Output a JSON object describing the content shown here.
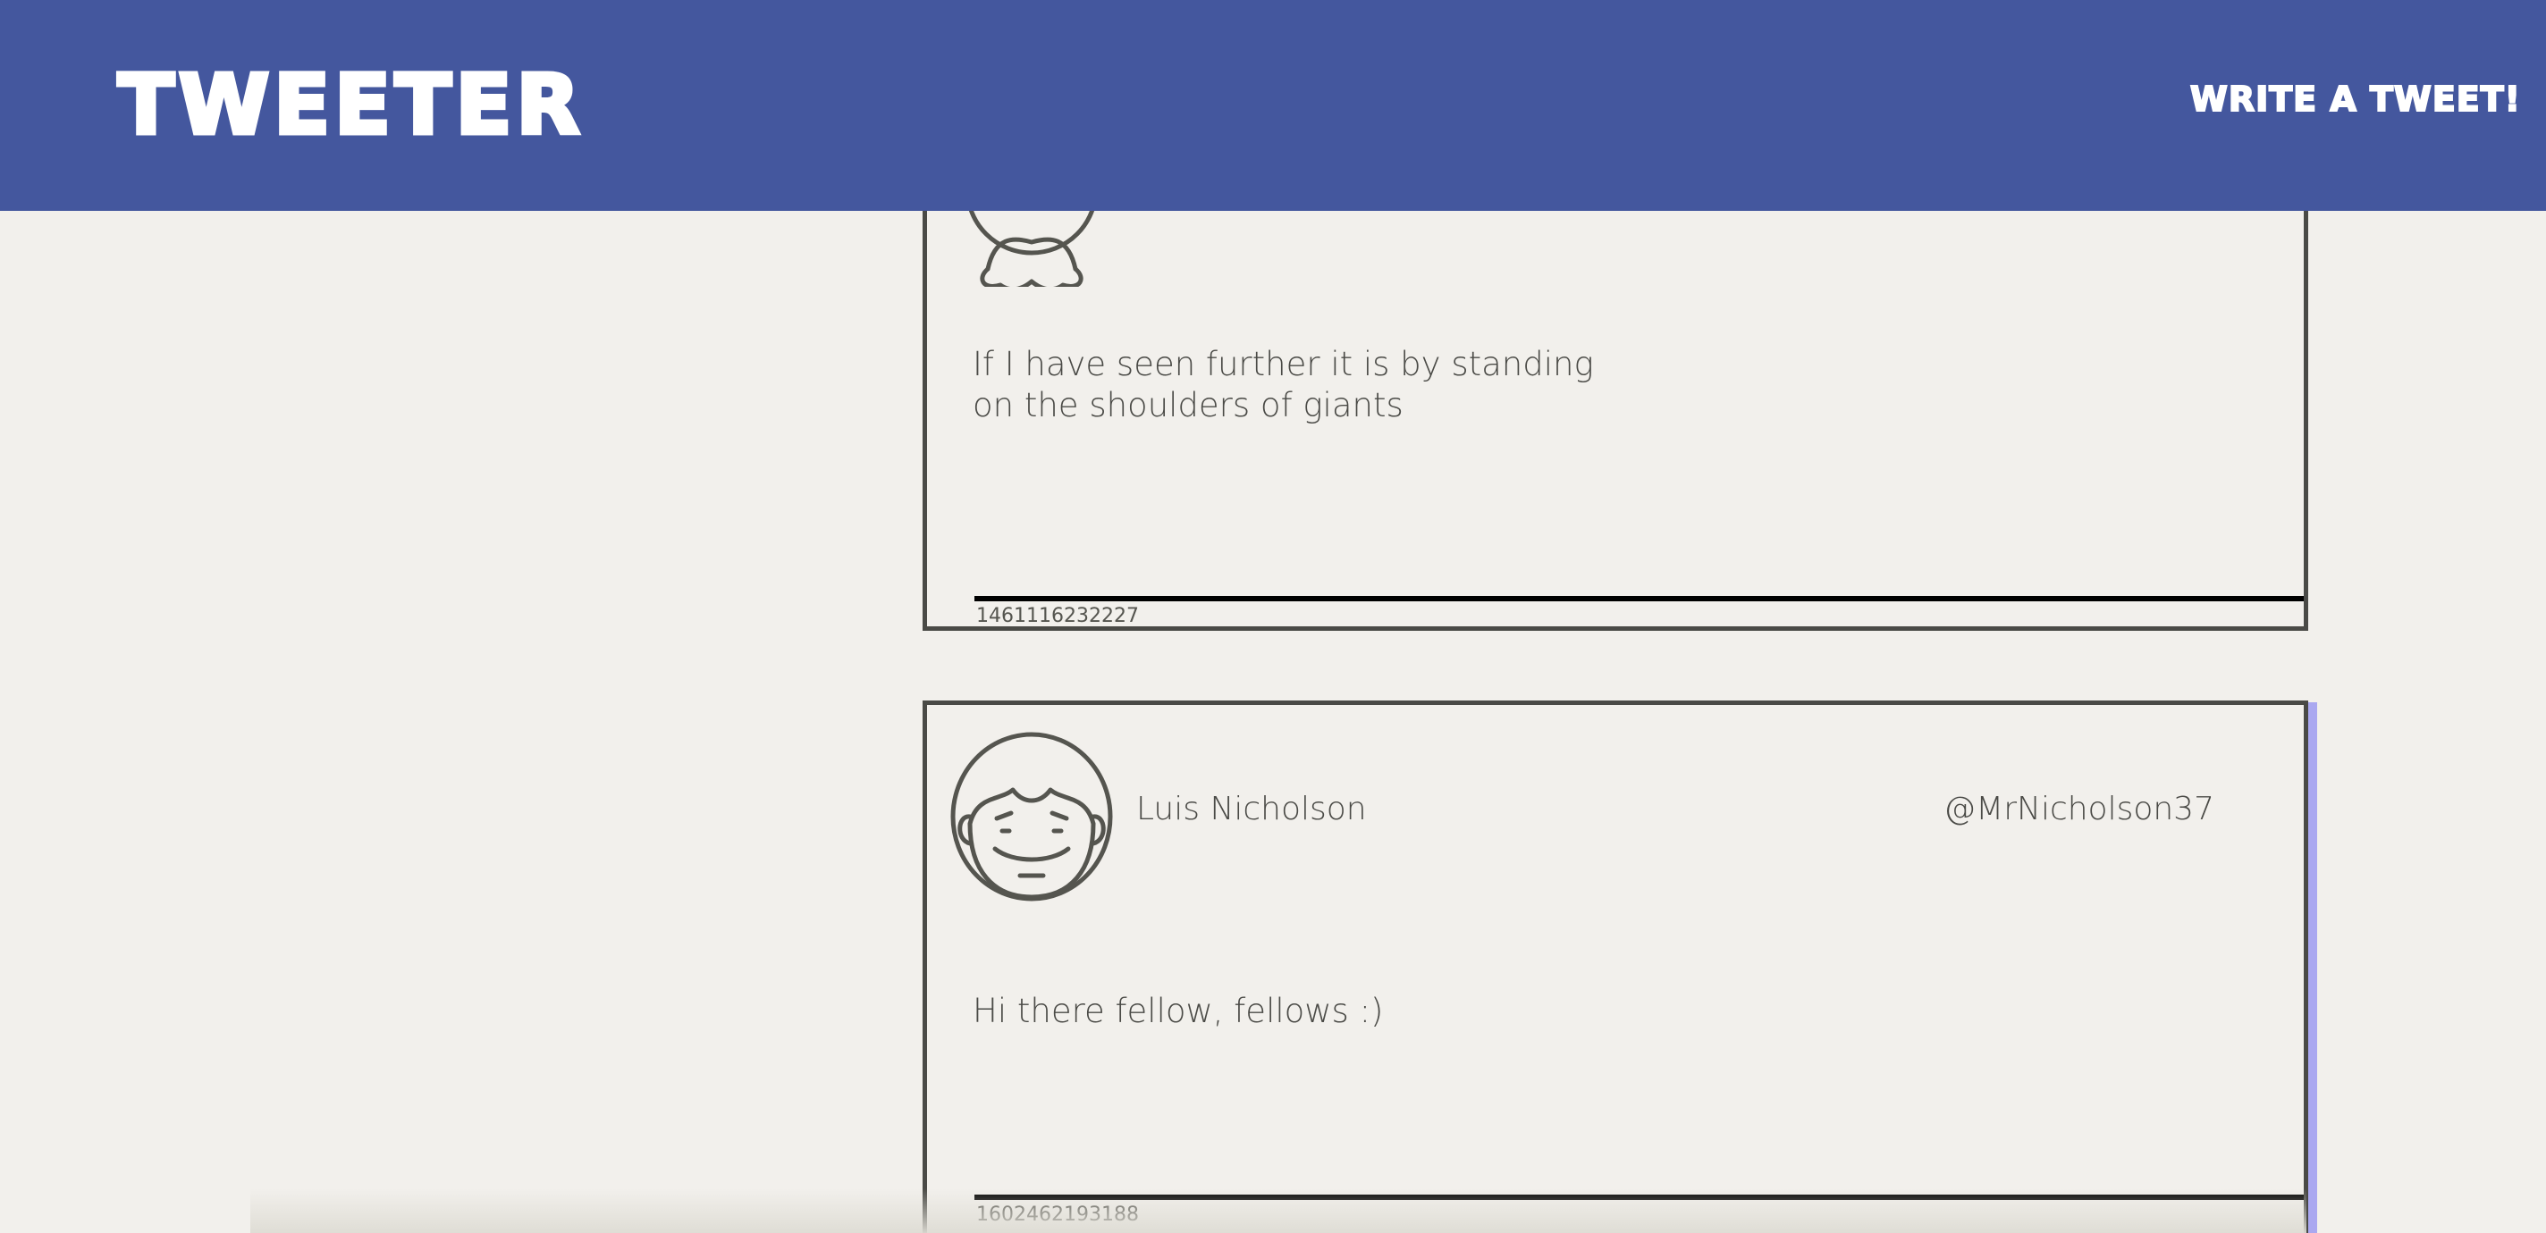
{
  "nav": {
    "brand": "TWEETER",
    "write_link": "WRITE A TWEET!"
  },
  "colors": {
    "nav_background": "#44579e",
    "page_background": "#f2f0ec",
    "card_border": "#4a4a46",
    "card_accent_shadow": "#aaa8f0"
  },
  "tweets": [
    {
      "avatar_icon": "avatar-face-icon",
      "name": "",
      "handle": "",
      "text": "If I have seen further it is by standing on the shoulders of giants",
      "timestamp": "1461116232227"
    },
    {
      "avatar_icon": "avatar-face-icon",
      "name": "Luis Nicholson",
      "handle": "@MrNicholson37",
      "text": "Hi there fellow, fellows :)",
      "timestamp": "1602462193188"
    }
  ]
}
